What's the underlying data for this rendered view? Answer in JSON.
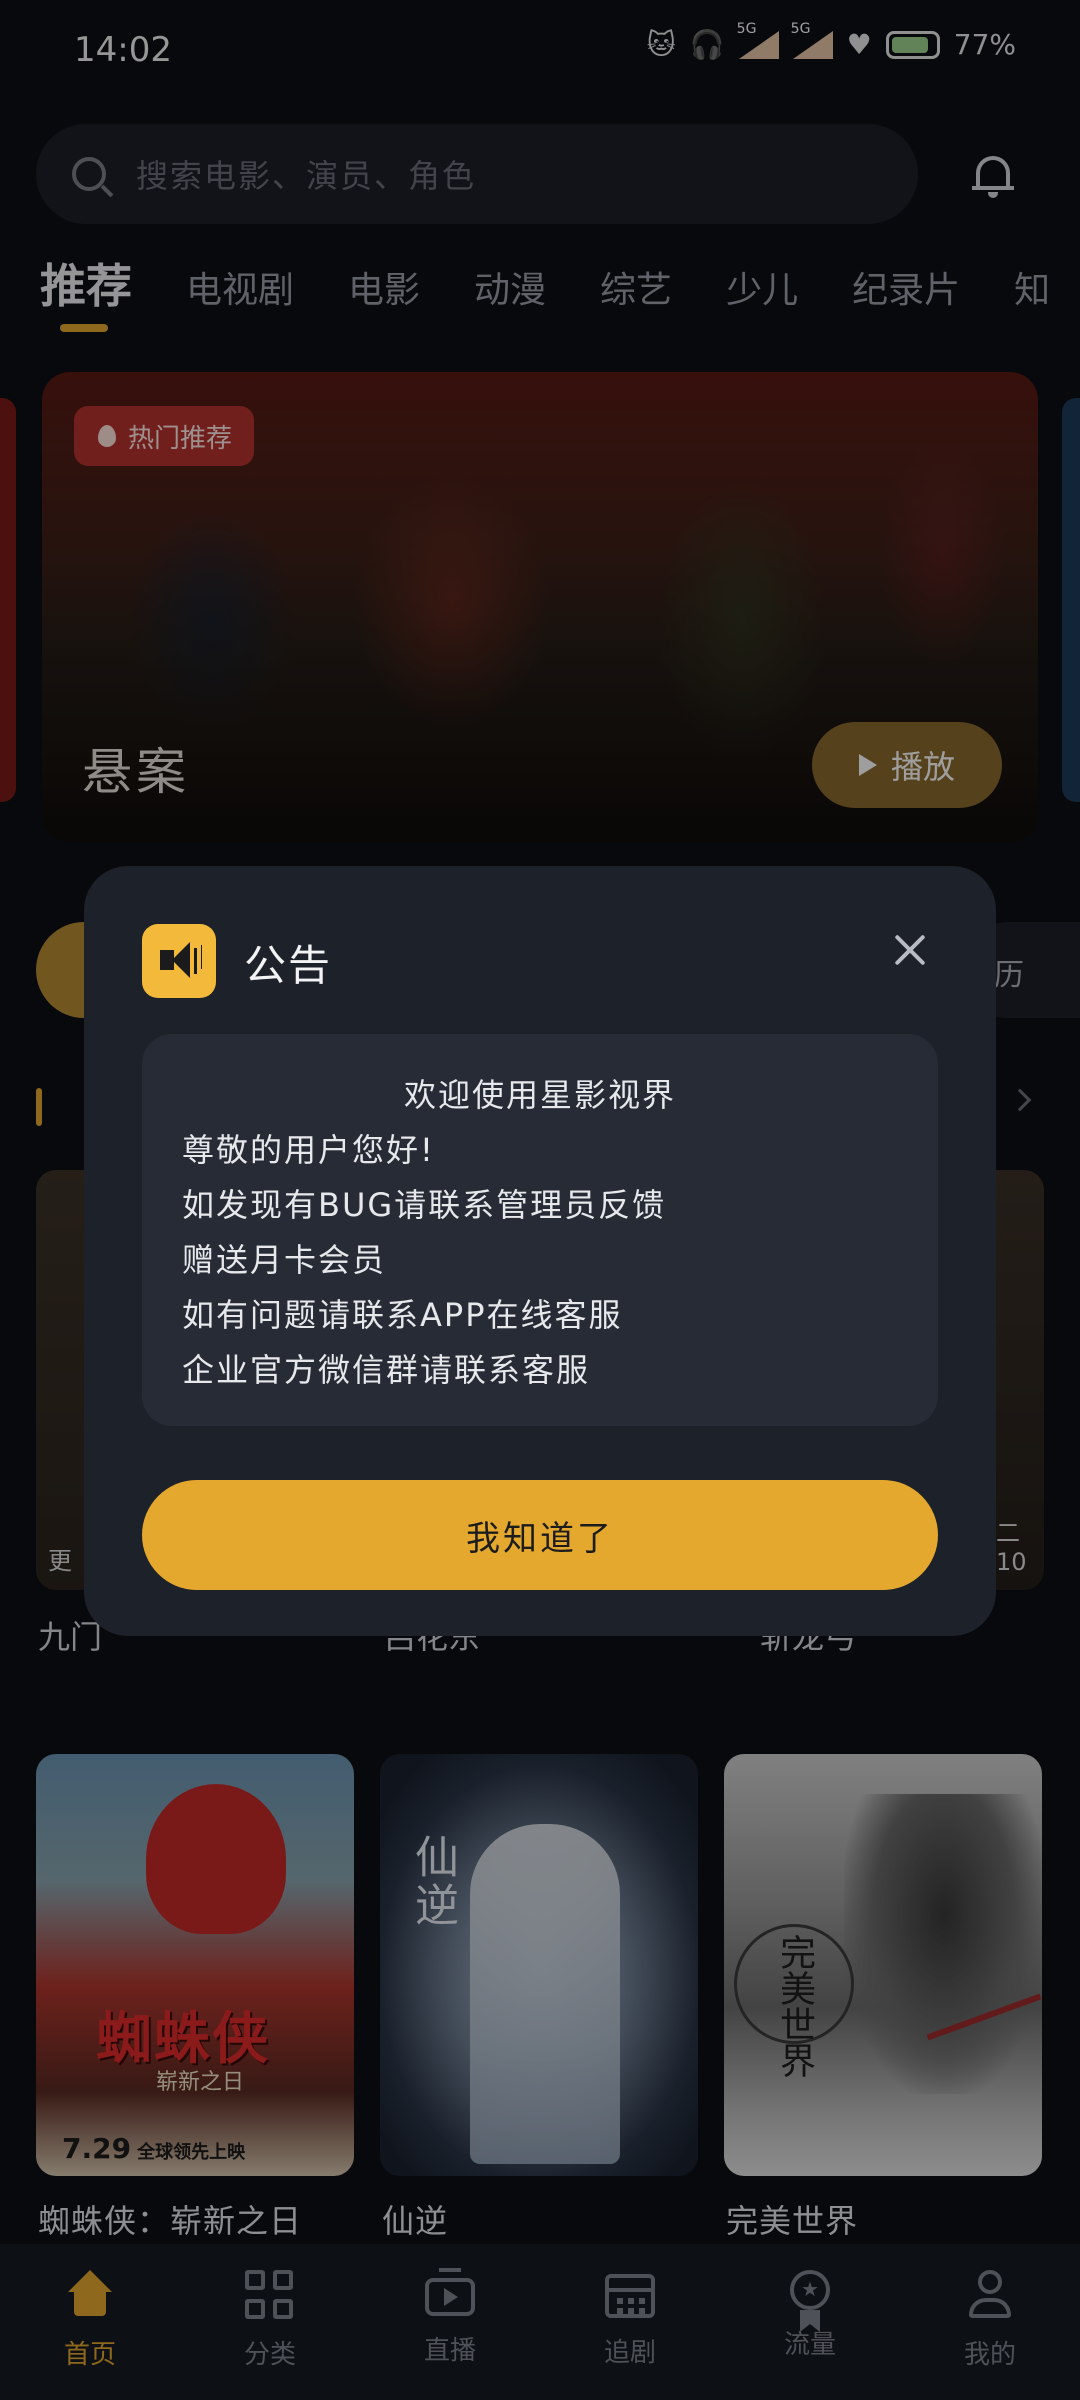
{
  "status_bar": {
    "time": "14:02",
    "battery": "77%",
    "network": "5G"
  },
  "search": {
    "placeholder": "搜索电影、演员、角色"
  },
  "tabs": [
    "推荐",
    "电视剧",
    "电影",
    "动漫",
    "综艺",
    "少儿",
    "纪录片",
    "知"
  ],
  "banner": {
    "badge": "热门推荐",
    "title": "悬案",
    "play_label": "播放"
  },
  "behind": {
    "chip_right": "历",
    "poster_left_tag": "更",
    "poster_right_tag": "二10",
    "label_left": "九门",
    "label_mid": "吕花东",
    "label_right": "斩龙弓"
  },
  "posters": [
    {
      "title": "蜘蛛侠：崭新之日",
      "art_title": "蜘蛛侠",
      "art_sub": "崭新之日",
      "art_date": "7.29",
      "art_date_note": "全球领先上映"
    },
    {
      "title": "仙逆",
      "art_title": "仙逆"
    },
    {
      "title": "完美世界",
      "art_title": "完美世界"
    }
  ],
  "nav": [
    {
      "label": "首页",
      "icon": "home-icon",
      "active": true
    },
    {
      "label": "分类",
      "icon": "grid-icon",
      "active": false
    },
    {
      "label": "直播",
      "icon": "tv-icon",
      "active": false
    },
    {
      "label": "追剧",
      "icon": "calendar-icon",
      "active": false
    },
    {
      "label": "流量",
      "icon": "badge-icon",
      "active": false
    },
    {
      "label": "我的",
      "icon": "user-icon",
      "active": false
    }
  ],
  "dialog": {
    "title": "公告",
    "heading": "欢迎使用星影视界",
    "lines": [
      "尊敬的用户您好!",
      "如发现有BUG请联系管理员反馈",
      "赠送月卡会员",
      "如有问题请联系APP在线客服",
      "企业官方微信群请联系客服"
    ],
    "confirm_label": "我知道了"
  },
  "colors": {
    "accent": "#e5a82e",
    "background": "#0d1016",
    "dialog": "#1d2129",
    "badge_red": "#b5322e"
  }
}
